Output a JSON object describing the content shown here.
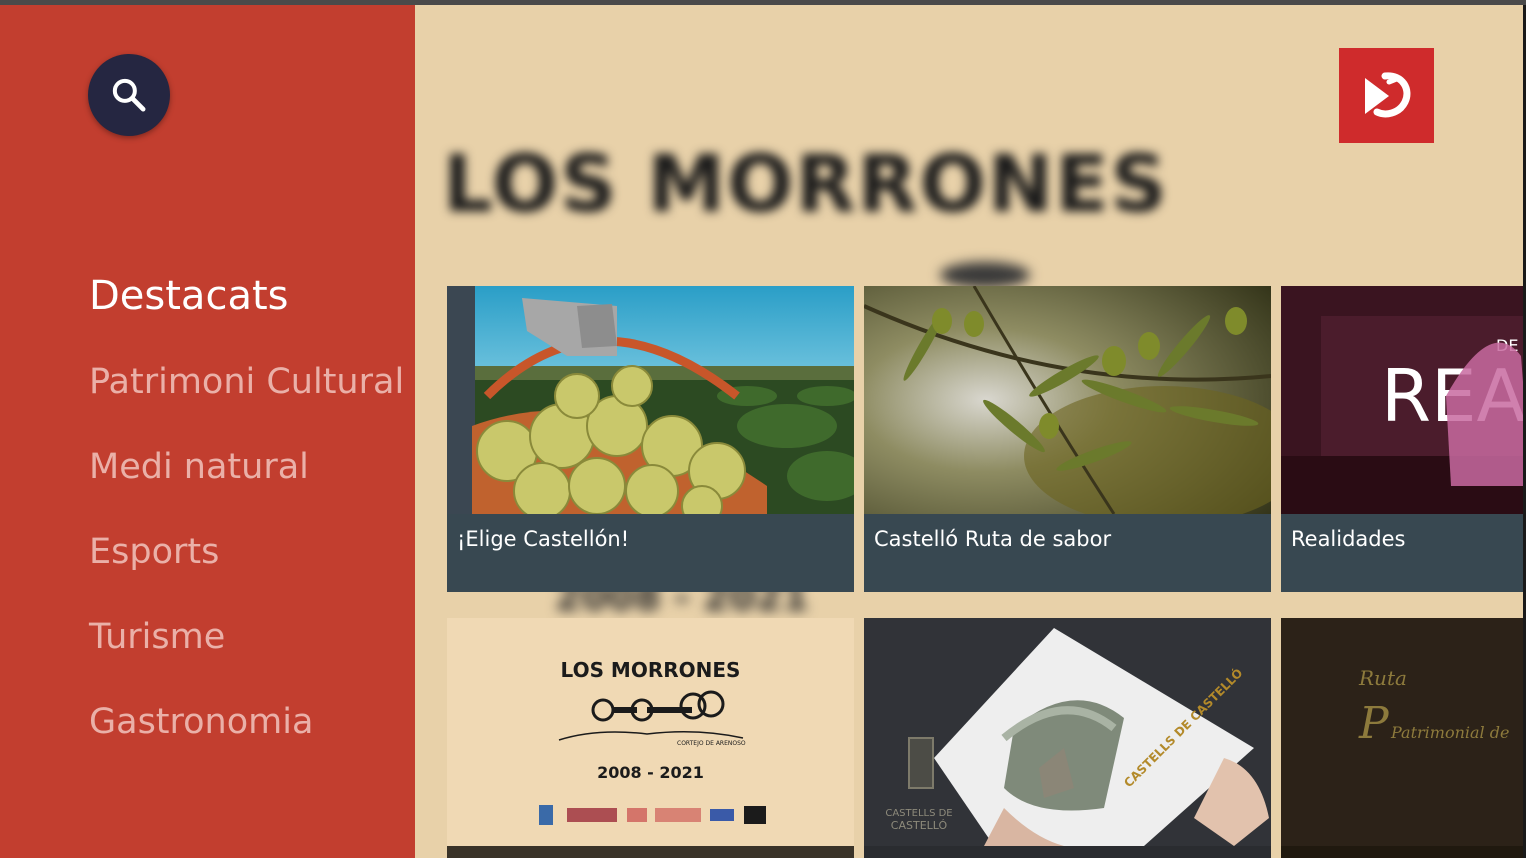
{
  "sidebar": {
    "search_icon": "search-icon",
    "items": [
      {
        "label": "Destacats",
        "active": true
      },
      {
        "label": "Patrimoni Cultural",
        "active": false
      },
      {
        "label": "Medi natural",
        "active": false
      },
      {
        "label": "Esports",
        "active": false
      },
      {
        "label": "Turisme",
        "active": false
      },
      {
        "label": "Gastronomia",
        "active": false
      }
    ]
  },
  "background": {
    "title": "LOS MORRONES",
    "years": "2008 - 2021"
  },
  "brand": {
    "logo_icon": "channel-logo-icon",
    "color": "#cf2b2c"
  },
  "cards_row1": [
    {
      "label": "¡Elige Castellón!"
    },
    {
      "label": "Castelló Ruta de sabor"
    },
    {
      "label": "Realidades",
      "image_text": "REALIDA",
      "image_small": "DE"
    }
  ],
  "cards_row2": [
    {
      "poster_title": "LOS MORRONES",
      "poster_sub": "CORTEJO DE ARENOSO",
      "poster_years": "2008 - 2021"
    },
    {
      "logo_line1": "CASTELLS DE",
      "logo_line2": "CASTELLÓ",
      "book_title": "CASTELLS DE CASTELLÓ"
    },
    {
      "line1": "Ruta",
      "line2": "Patrimonial de"
    }
  ],
  "colors": {
    "sidebar": "#c23e2f",
    "search_button": "#252641",
    "page_bg": "#e8d1a9",
    "card_footer": "#384851",
    "nav_inactive": "#eab0a8"
  }
}
